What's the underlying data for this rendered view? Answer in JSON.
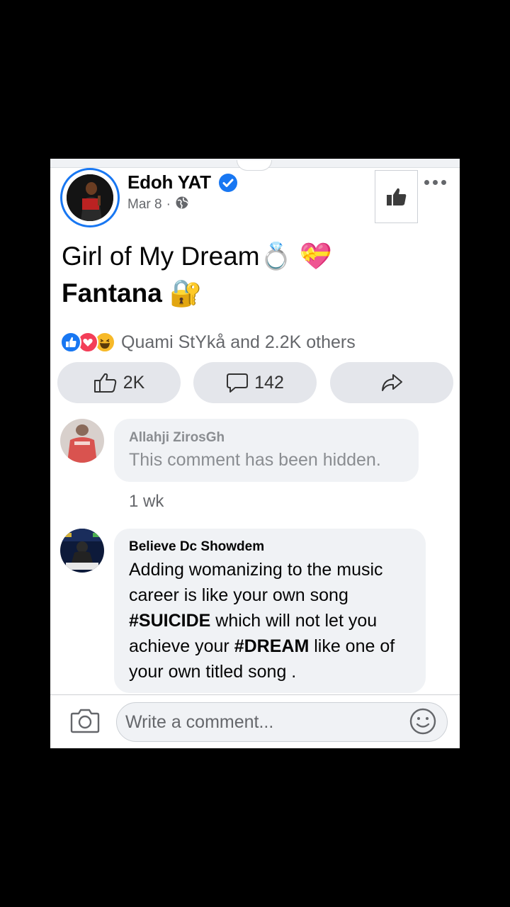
{
  "post": {
    "author": "Edoh YAT",
    "date": "Mar 8",
    "separator": "·",
    "text_line1": "Girl of My Dream",
    "text_line1_emoji": "💍 💝",
    "text_line2": "Fantana",
    "text_line2_emoji": "🔐"
  },
  "reactions": {
    "summary": "Quami StYkå and 2.2K others"
  },
  "actions": {
    "like_count": "2K",
    "comment_count": "142"
  },
  "comments": [
    {
      "name": "Allahji ZirosGh",
      "text": "This comment has been hidden.",
      "time": "1 wk"
    },
    {
      "name": "Believe Dc Showdem",
      "text_1": "Adding womanizing to the music",
      "text_2": "career is like your own song",
      "text_3_bold": "#SUICIDE",
      "text_3": " which will not let you",
      "text_4_pre": "achieve your ",
      "text_4_bold": "#DREAM",
      "text_4": " like one of",
      "text_5": "your own titled song ."
    }
  ],
  "composer": {
    "placeholder": "Write a comment..."
  },
  "colors": {
    "brand_blue": "#1877f2",
    "secondary_text": "#65676b",
    "bubble_bg": "#f0f2f5"
  }
}
